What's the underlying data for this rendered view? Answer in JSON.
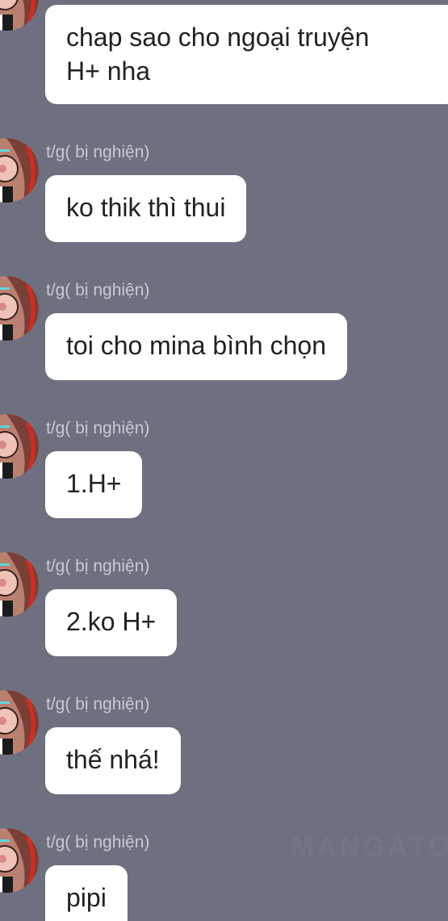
{
  "chat": {
    "first_message": {
      "text_line1": "chap sao cho ngoại truyện",
      "text_line2": "H+ nha"
    },
    "messages": [
      {
        "sender": "t/g( bị nghiện)",
        "text": "ko thik thì thui"
      },
      {
        "sender": "t/g( bị nghiện)",
        "text": "toi cho mina bình chọn"
      },
      {
        "sender": "t/g( bị nghiện)",
        "text": "1.H+"
      },
      {
        "sender": "t/g( bị nghiện)",
        "text": "2.ko H+"
      },
      {
        "sender": "t/g( bị nghiện)",
        "text": "thế nhá!"
      },
      {
        "sender": "t/g( bị nghiện)",
        "text": "pipi"
      }
    ]
  },
  "watermark": "MANGATO",
  "colors": {
    "background": "#6e7080",
    "bubble": "#ffffff",
    "sender_text": "#c9cad3",
    "message_text": "#222222"
  },
  "icons": {
    "avatar": "anime-character-avatar-icon"
  }
}
